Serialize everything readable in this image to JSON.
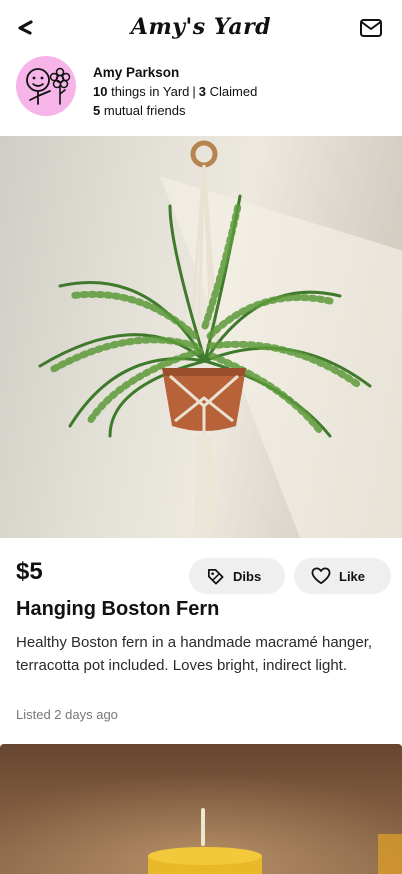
{
  "header": {
    "title": "Amy's Yard"
  },
  "profile": {
    "name": "Amy Parkson",
    "things_count": "10",
    "things_label": "things in Yard",
    "separator": "|",
    "claimed_count": "3",
    "claimed_label": "Claimed",
    "mutual_count": "5",
    "mutual_label": "mutual friends"
  },
  "listing": {
    "price": "$5",
    "dibs_label": "Dibs",
    "like_label": "Like",
    "title": "Hanging Boston Fern",
    "description": "Healthy Boston fern in a handmade macramé hanger, terracotta pot included. Loves bright, indirect light.",
    "listed": "Listed 2 days ago"
  },
  "icons": {
    "back": "back-chevron-icon",
    "mail": "mail-icon",
    "dibs": "tag-icon",
    "like": "heart-icon"
  },
  "colors": {
    "avatar_bg": "#f6b4e8",
    "pill_bg": "#efefef"
  }
}
